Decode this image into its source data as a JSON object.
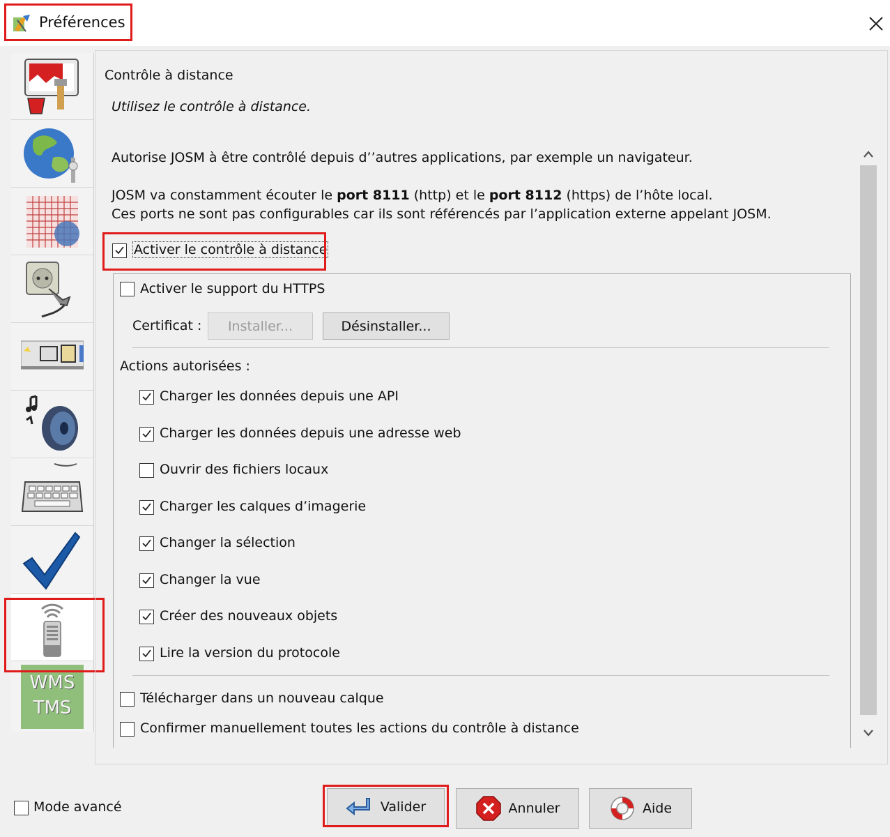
{
  "window": {
    "title": "Préférences",
    "close_icon": "close-icon"
  },
  "sidebar": {
    "items": [
      {
        "icon": "display-paint-icon"
      },
      {
        "icon": "globe-connection-icon"
      },
      {
        "icon": "grid-projection-icon"
      },
      {
        "icon": "plugin-plug-icon"
      },
      {
        "icon": "toolbar-icon"
      },
      {
        "icon": "audio-speaker-icon"
      },
      {
        "icon": "keyboard-shortcut-icon"
      },
      {
        "icon": "validator-checkmark-icon"
      },
      {
        "icon": "remote-control-icon",
        "selected": true
      },
      {
        "icon": "wms-tms-icon",
        "text_line1": "WMS",
        "text_line2": "TMS"
      }
    ]
  },
  "main": {
    "section_title": "Contrôle à distance",
    "section_subtitle": "Utilisez le contrôle à distance.",
    "description": "Autorise JOSM à être contrôlé depuis d’’autres applications, par exemple un navigateur.",
    "ports_line1_a": "JOSM va constamment écouter le ",
    "ports_line1_b": "port 8111",
    "ports_line1_c": " (http) et le ",
    "ports_line1_d": "port 8112",
    "ports_line1_e": " (https) de l’hôte local.",
    "ports_line2": "Ces ports ne sont pas configurables car ils sont référencés par l’application externe appelant JOSM.",
    "enable_remote": {
      "label": "Activer le contrôle à distance",
      "checked": true
    },
    "https_support": {
      "label": "Activer le support du HTTPS",
      "checked": false
    },
    "certificate_label": "Certificat :",
    "install_button": "Installer...",
    "uninstall_button": "Désinstaller...",
    "actions_heading": "Actions autorisées :",
    "actions": [
      {
        "label": "Charger les données depuis une API",
        "checked": true
      },
      {
        "label": "Charger les données depuis une adresse web",
        "checked": true
      },
      {
        "label": "Ouvrir des fichiers locaux",
        "checked": false
      },
      {
        "label": "Charger les calques d’imagerie",
        "checked": true
      },
      {
        "label": "Changer la sélection",
        "checked": true
      },
      {
        "label": "Changer la vue",
        "checked": true
      },
      {
        "label": "Créer des nouveaux objets",
        "checked": true
      },
      {
        "label": "Lire la version du protocole",
        "checked": true
      }
    ],
    "download_new_layer": {
      "label": "Télécharger dans un nouveau calque",
      "checked": false
    },
    "confirm_actions": {
      "label": "Confirmer manuellement toutes les actions du contrôle à distance",
      "checked": false
    }
  },
  "footer": {
    "advanced_mode": {
      "label": "Mode avancé",
      "checked": false
    },
    "ok_button": "Valider",
    "cancel_button": "Annuler",
    "help_button": "Aide"
  },
  "colors": {
    "highlight": "#e01b1b",
    "ok_icon": "#3a7fd0",
    "cancel_icon": "#d52020",
    "help_icon": "#d52020"
  }
}
